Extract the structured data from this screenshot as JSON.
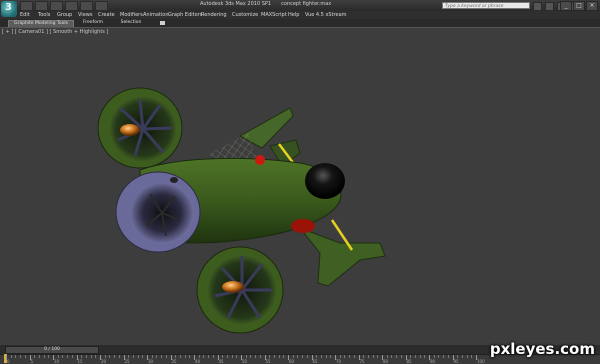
{
  "window": {
    "app_title": "Autodesk 3ds Max  2010 SP1",
    "file_name": "concept fighter.max",
    "search_placeholder": "Type a keyword or phrase",
    "controls": [
      "_",
      "□",
      "×"
    ]
  },
  "menu": {
    "items": [
      "Edit",
      "Tools",
      "Group",
      "Views",
      "Create",
      "Modifiers",
      "Animation",
      "Graph Editors",
      "Rendering",
      "Customize",
      "MAXScript",
      "Help",
      "Vue 4.5 xStream"
    ]
  },
  "ribbon": {
    "tabs": [
      "Graphite Modeling Tools",
      "Freeform",
      "Selection"
    ],
    "active_tab": "Graphite Modeling Tools"
  },
  "viewport": {
    "label": "[ + ] [ Camera01 ] [ Smooth + Highlights ]",
    "background": "#3d3d3d"
  },
  "timeline": {
    "current_frame": 0,
    "total_frames": 100,
    "slider_text": "0 / 100",
    "tick_labels": [
      "0",
      "5",
      "10",
      "15",
      "20",
      "25",
      "30",
      "35",
      "40",
      "45",
      "50",
      "55",
      "60",
      "65",
      "70",
      "75",
      "80",
      "85",
      "90",
      "95",
      "100"
    ]
  },
  "watermark": "pxleyes.com",
  "colors": {
    "hull_green": "#3b5a1e",
    "engine_blue": "#6a6a9a",
    "accent_yellow": "#e8d020",
    "accent_red": "#cc1a10",
    "cockpit": "#111111"
  }
}
